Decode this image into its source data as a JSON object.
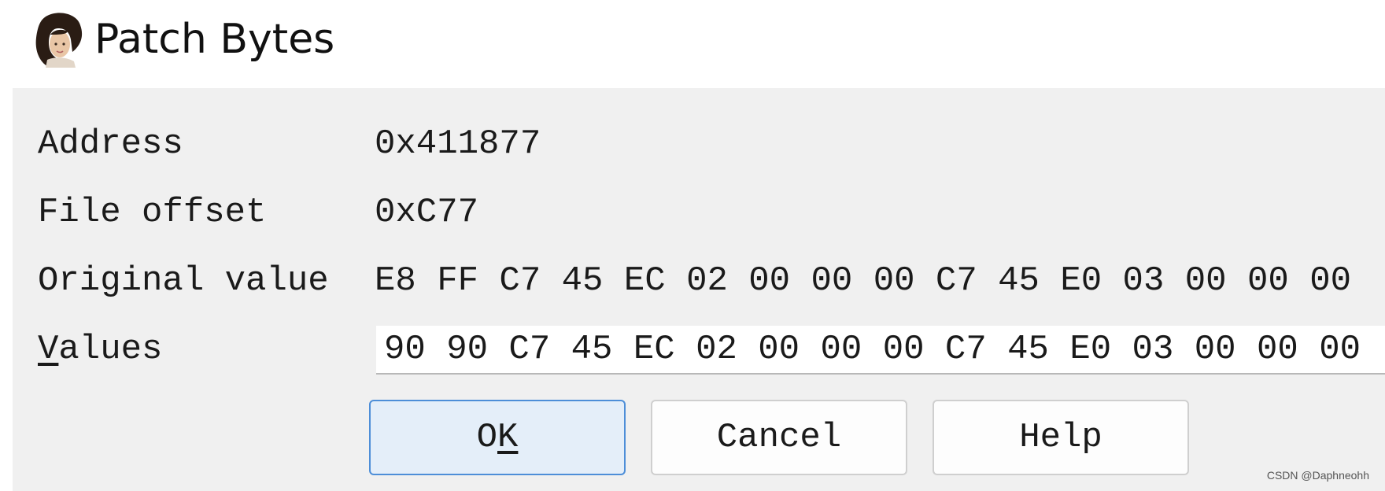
{
  "window": {
    "title": "Patch Bytes",
    "icon": "portrait-app-icon"
  },
  "fields": {
    "address": {
      "label": "Address",
      "value": "0x411877"
    },
    "file_offset": {
      "label": "File offset",
      "value": "0xC77"
    },
    "original_value": {
      "label": "Original value",
      "value": "E8 FF C7 45 EC 02 00 00 00 C7 45 E0 03 00 00 00"
    },
    "values": {
      "label_mnemonic": "V",
      "label_rest": "alues",
      "value": "90 90 C7 45 EC 02 00 00 00 C7 45 E0 03 00 00 00"
    }
  },
  "buttons": {
    "ok_prefix": "O",
    "ok_mnemonic": "K",
    "cancel": "Cancel",
    "help": "Help"
  },
  "watermark": "CSDN @Daphneohh",
  "colors": {
    "dialog_background": "#f0f0f0",
    "default_button_border": "#4d8ed8",
    "default_button_fill": "#e4eef9"
  }
}
